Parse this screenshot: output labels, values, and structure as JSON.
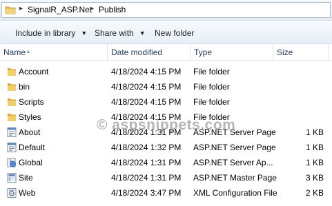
{
  "address": {
    "crumbs": [
      "SignalR_ASP.Net",
      "Publish"
    ],
    "separator": "▸"
  },
  "toolbar": {
    "include_label": "Include in library",
    "share_label": "Share with",
    "newfolder_label": "New folder"
  },
  "columns": {
    "name": "Name",
    "date": "Date modified",
    "type": "Type",
    "size": "Size"
  },
  "files": [
    {
      "name": "Account",
      "date": "4/18/2024 4:15 PM",
      "type": "File folder",
      "size": "",
      "icon": "folder-icon"
    },
    {
      "name": "bin",
      "date": "4/18/2024 4:15 PM",
      "type": "File folder",
      "size": "",
      "icon": "folder-icon"
    },
    {
      "name": "Scripts",
      "date": "4/18/2024 4:15 PM",
      "type": "File folder",
      "size": "",
      "icon": "folder-icon"
    },
    {
      "name": "Styles",
      "date": "4/18/2024 4:15 PM",
      "type": "File folder",
      "size": "",
      "icon": "folder-icon"
    },
    {
      "name": "About",
      "date": "4/18/2024 1:31 PM",
      "type": "ASP.NET Server Page",
      "size": "1 KB",
      "icon": "aspx-page-icon"
    },
    {
      "name": "Default",
      "date": "4/18/2024 1:32 PM",
      "type": "ASP.NET Server Page",
      "size": "1 KB",
      "icon": "aspx-page-icon"
    },
    {
      "name": "Global",
      "date": "4/18/2024 1:31 PM",
      "type": "ASP.NET Server Ap...",
      "size": "1 KB",
      "icon": "global-asax-icon"
    },
    {
      "name": "Site",
      "date": "4/18/2024 1:31 PM",
      "type": "ASP.NET Master Page",
      "size": "3 KB",
      "icon": "master-page-icon"
    },
    {
      "name": "Web",
      "date": "4/18/2024 3:47 PM",
      "type": "XML Configuration File",
      "size": "2 KB",
      "icon": "config-file-icon"
    }
  ],
  "watermark": "© aspsnippets.com",
  "colors": {
    "folder": "#e8c15a",
    "header_text": "#1e395b",
    "accent": "#3a7bd5"
  }
}
